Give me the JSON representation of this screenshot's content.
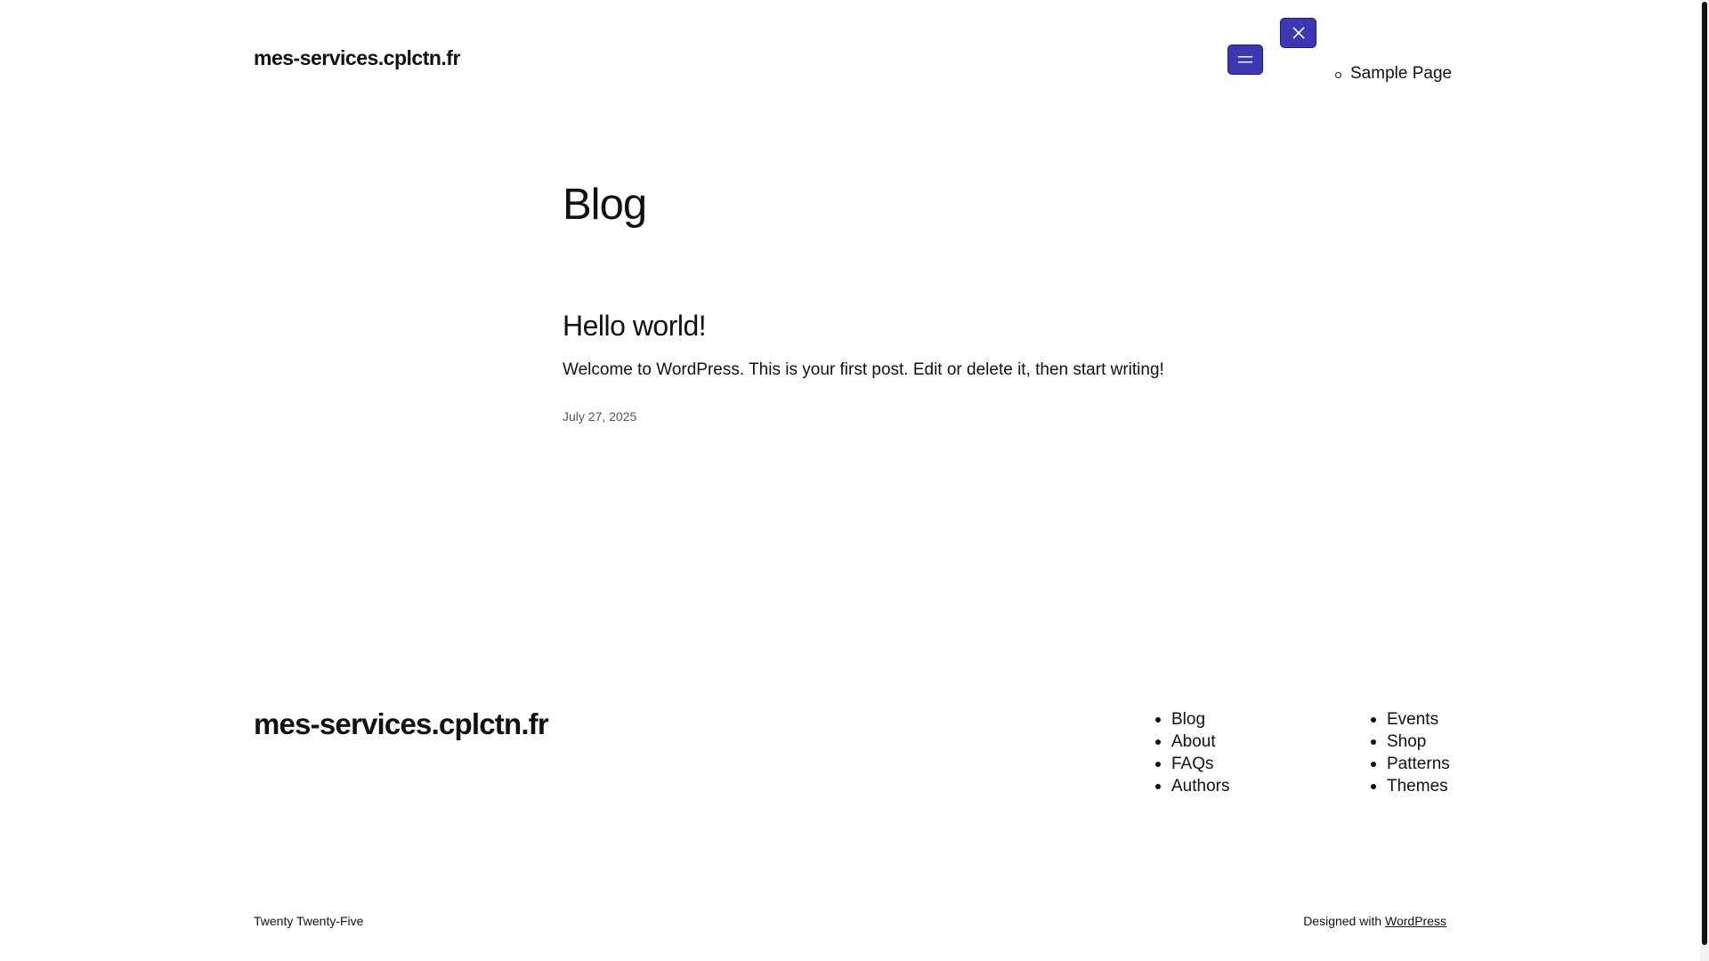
{
  "header": {
    "site_title": "mes-services.cplctn.fr",
    "nav_items": [
      "Sample Page"
    ]
  },
  "main": {
    "heading": "Blog",
    "post": {
      "title": "Hello world!",
      "excerpt": "Welcome to WordPress. This is your first post. Edit or delete it, then start writing!",
      "date": "July 27, 2025"
    }
  },
  "footer": {
    "site_title": "mes-services.cplctn.fr",
    "col1": [
      "Blog",
      "About",
      "FAQs",
      "Authors"
    ],
    "col2": [
      "Events",
      "Shop",
      "Patterns",
      "Themes"
    ],
    "theme_credit": "Twenty Twenty-Five",
    "designed_with_prefix": "Designed with",
    "designed_with_link": "WordPress"
  },
  "icons": {
    "menu_open": "hamburger-icon",
    "menu_close": "close-icon"
  },
  "colors": {
    "button_bg": "#3c37b3",
    "text": "#111111"
  }
}
